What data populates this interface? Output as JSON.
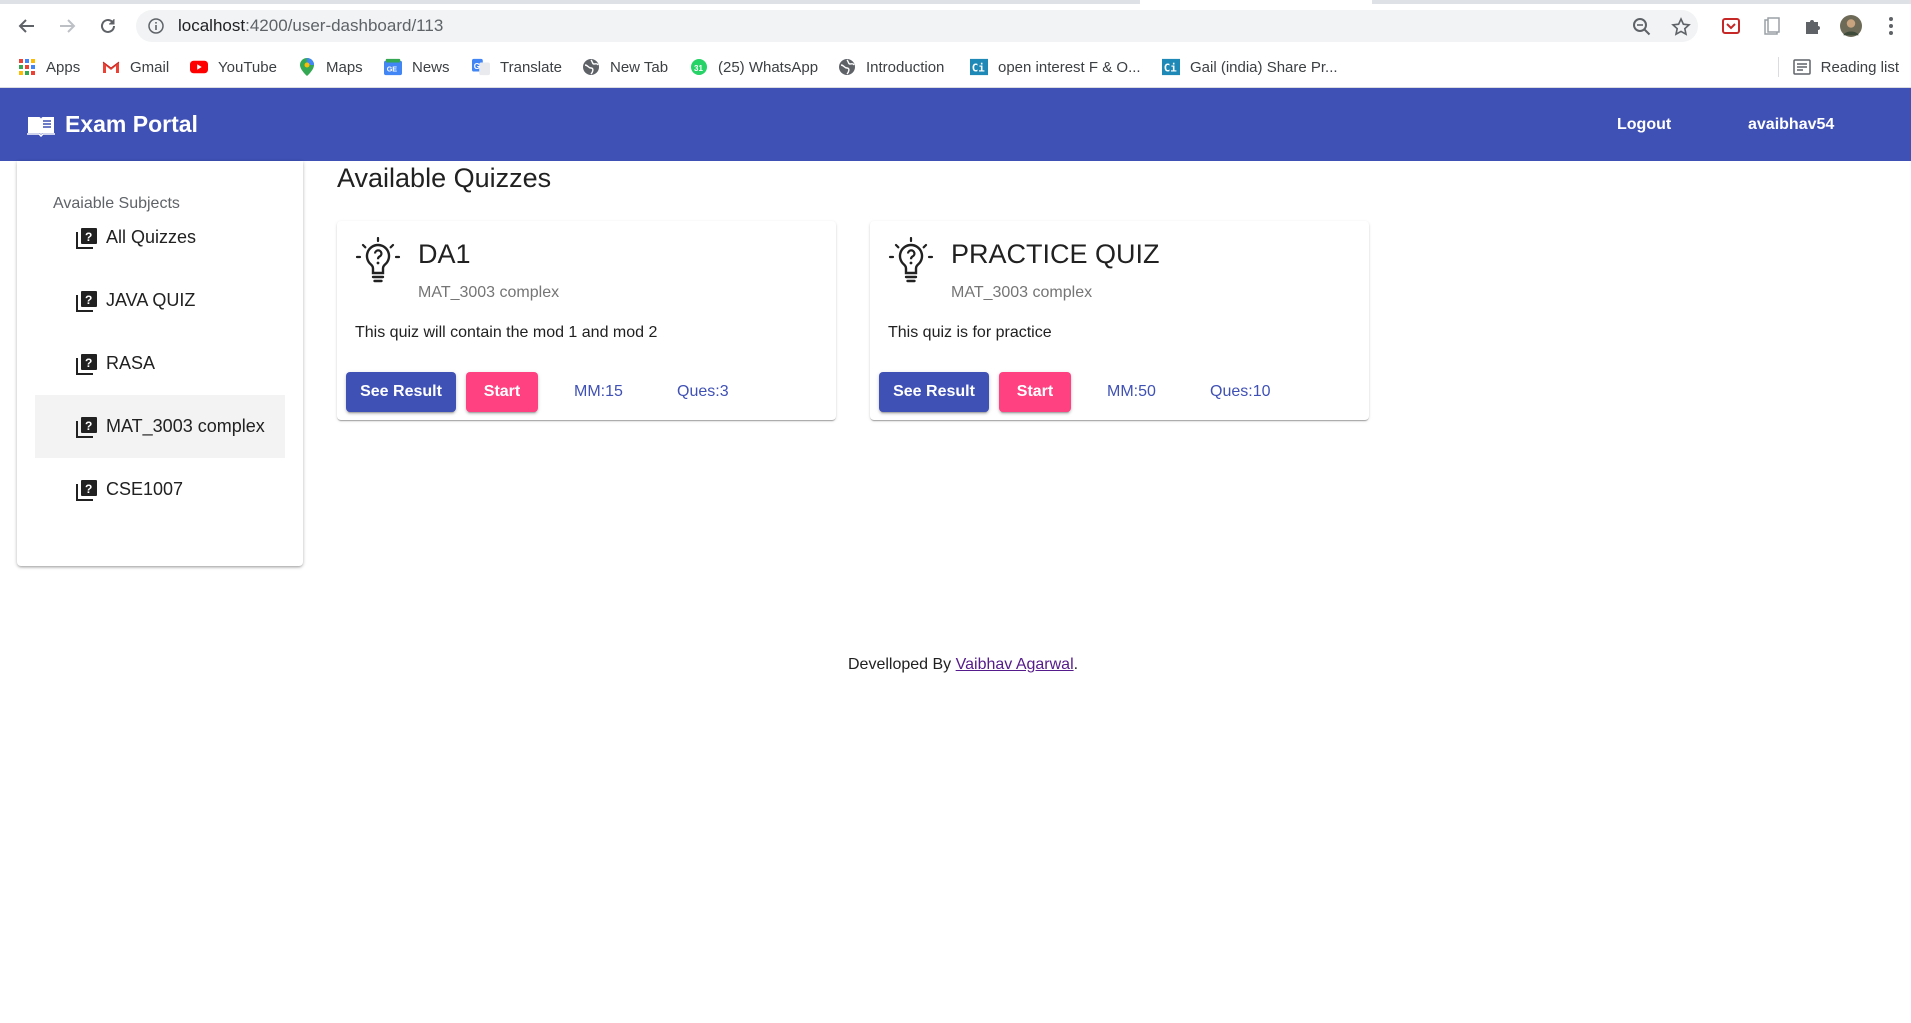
{
  "browser": {
    "url_host": "localhost",
    "url_path": ":4200/user-dashboard/113",
    "bookmarks": [
      {
        "label": "Apps",
        "icon": "apps-grid-icon"
      },
      {
        "label": "Gmail",
        "icon": "gmail-icon"
      },
      {
        "label": "YouTube",
        "icon": "youtube-icon"
      },
      {
        "label": "Maps",
        "icon": "maps-pin-icon"
      },
      {
        "label": "News",
        "icon": "google-news-icon"
      },
      {
        "label": "Translate",
        "icon": "translate-icon"
      },
      {
        "label": "New Tab",
        "icon": "globe-icon"
      },
      {
        "label": "(25) WhatsApp",
        "icon": "whatsapp-icon"
      },
      {
        "label": "Introduction",
        "icon": "globe-icon"
      },
      {
        "label": "open interest F & O...",
        "icon": "ci-icon"
      },
      {
        "label": "Gail (india) Share Pr...",
        "icon": "ci-icon"
      }
    ],
    "reading_list": "Reading list"
  },
  "navbar": {
    "brand": "Exam Portal",
    "logout": "Logout",
    "username": "avaibhav54",
    "color": "#3f51b5"
  },
  "sidebar": {
    "subheader": "Avaiable Subjects",
    "items": [
      {
        "label": "All Quizzes",
        "active": false
      },
      {
        "label": "JAVA QUIZ",
        "active": false
      },
      {
        "label": "RASA",
        "active": false
      },
      {
        "label": "MAT_3003 complex",
        "active": true
      },
      {
        "label": "CSE1007",
        "active": false
      }
    ]
  },
  "main": {
    "title": "Available Quizzes",
    "quizzes": [
      {
        "title": "DA1",
        "subject": "MAT_3003 complex",
        "description": "This quiz will contain the mod 1 and mod 2",
        "see_result": "See Result",
        "start": "Start",
        "max_marks": "MM:15",
        "questions": "Ques:3"
      },
      {
        "title": "PRACTICE QUIZ",
        "subject": "MAT_3003 complex",
        "description": "This quiz is for practice",
        "see_result": "See Result",
        "start": "Start",
        "max_marks": "MM:50",
        "questions": "Ques:10"
      }
    ],
    "accent_color": "#ff4081"
  },
  "footer": {
    "prefix": "Develloped By ",
    "author": "Vaibhav Agarwal",
    "suffix": "."
  }
}
